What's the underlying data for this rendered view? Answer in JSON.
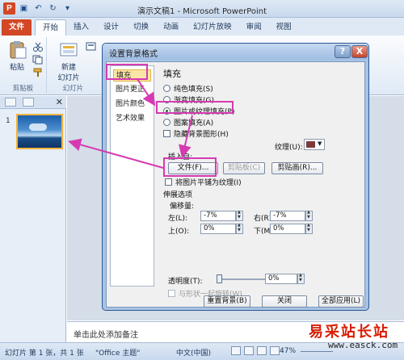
{
  "app": {
    "window_title": "演示文稿1 - Microsoft PowerPoint"
  },
  "ribbon": {
    "tabs": [
      "文件",
      "开始",
      "插入",
      "设计",
      "切换",
      "动画",
      "幻灯片放映",
      "审阅",
      "视图"
    ],
    "paste_label": "粘贴",
    "new_slide_label": "新建",
    "new_slide_label2": "幻灯片",
    "clipboard_group": "剪贴板",
    "slides_group": "幻灯片"
  },
  "left_pane": {
    "slide_number": "1"
  },
  "notes": {
    "placeholder": "单击此处添加备注"
  },
  "status": {
    "slide_info": "幻灯片 第 1 张，共 1 张",
    "theme": "\"Office 主题\"",
    "language": "中文(中国)",
    "zoom": "47%"
  },
  "dialog": {
    "title": "设置背景格式",
    "help": "?",
    "close": "X",
    "nav": [
      "填充",
      "图片更正",
      "图片颜色",
      "艺术效果"
    ],
    "section_title": "填充",
    "fill_options": [
      "纯色填充(S)",
      "渐变填充(G)",
      "图片或纹理填充(P)",
      "图案填充(A)"
    ],
    "selected_fill_index": 2,
    "hide_bg_graphics": "隐藏背景图形(H)",
    "texture_label": "纹理(U):",
    "insert_from_label": "插入自:",
    "file_button": "文件(F)...",
    "clipboard_button": "剪贴板(C)",
    "clipart_button": "剪贴画(R)...",
    "tile_checkbox": "将图片平铺为纹理(I)",
    "stretch_label": "伸展选项",
    "offset_label": "偏移量:",
    "offsets": {
      "left_label": "左(L):",
      "left_value": "-7%",
      "right_label": "右(R):",
      "right_value": "-7%",
      "top_label": "上(O):",
      "top_value": "0%",
      "bottom_label": "下(M):",
      "bottom_value": "0%"
    },
    "transparency_label": "透明度(T):",
    "transparency_value": "0%",
    "rotate_with_shape": "与形状一起旋转(W)",
    "reset_button": "重置背景(B)",
    "close_button": "关闭",
    "apply_all_button": "全部应用(L)"
  },
  "watermark": {
    "text": "易采站长站",
    "url": "www.easck.com"
  },
  "colors": {
    "accent_file_tab": "#d24726",
    "annotation_pink": "#d63ab2",
    "nav_selected": "#fbe6a8"
  }
}
